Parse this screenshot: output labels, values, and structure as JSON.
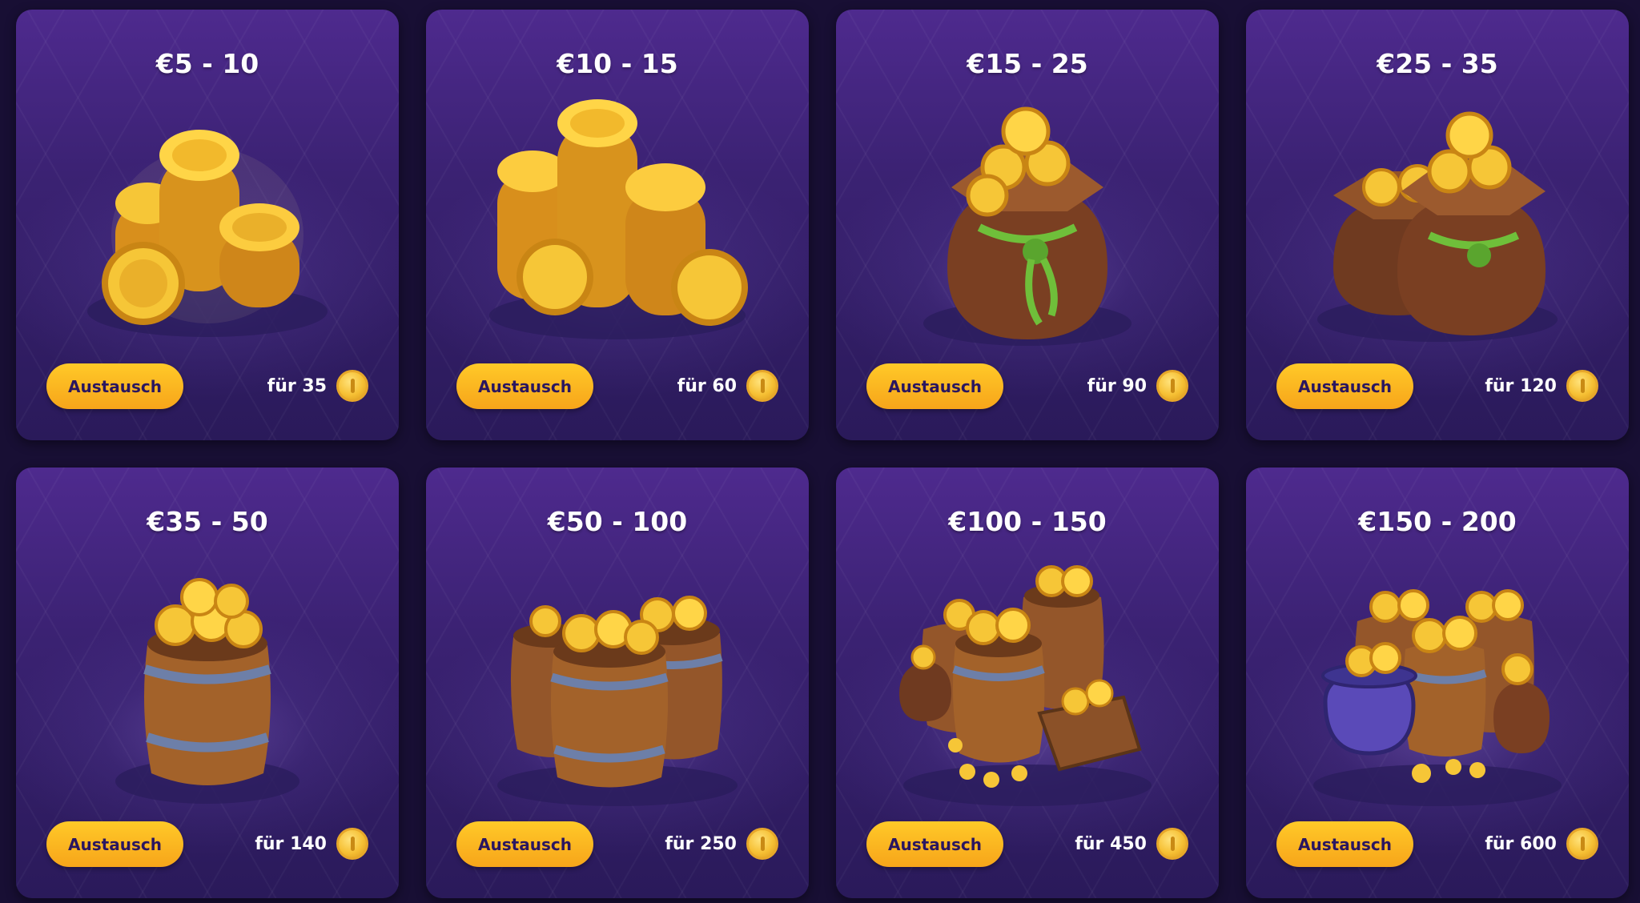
{
  "cards": [
    {
      "title": "€5 - 10",
      "button_label": "Austausch",
      "price_label": "für 35",
      "art_icon": "coin-pile-icon"
    },
    {
      "title": "€10 - 15",
      "button_label": "Austausch",
      "price_label": "für 60",
      "art_icon": "coin-stacks-icon"
    },
    {
      "title": "€15 - 25",
      "button_label": "Austausch",
      "price_label": "für 90",
      "art_icon": "coin-sack-icon"
    },
    {
      "title": "€25 - 35",
      "button_label": "Austausch",
      "price_label": "für 120",
      "art_icon": "two-coin-sacks-icon"
    },
    {
      "title": "€35 - 50",
      "button_label": "Austausch",
      "price_label": "für 140",
      "art_icon": "coin-barrel-icon"
    },
    {
      "title": "€50 - 100",
      "button_label": "Austausch",
      "price_label": "für 250",
      "art_icon": "two-coin-barrels-icon"
    },
    {
      "title": "€100 - 150",
      "button_label": "Austausch",
      "price_label": "für 450",
      "art_icon": "coin-barrels-crate-icon"
    },
    {
      "title": "€150 - 200",
      "button_label": "Austausch",
      "price_label": "für 600",
      "art_icon": "coin-treasure-hoard-icon"
    }
  ],
  "price_icon": "coin-icon",
  "colors": {
    "page_background": "#180f34",
    "card_top": "#4e2a8e",
    "card_bottom": "#2a1a5a",
    "button": "#f8b51f",
    "button_text": "#2a1660",
    "gold": "#f6c034"
  }
}
